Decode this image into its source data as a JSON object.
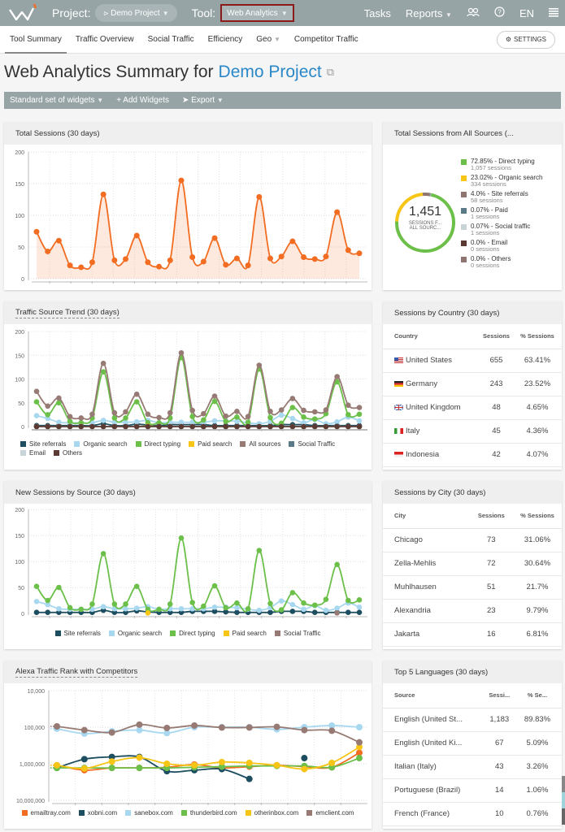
{
  "topbar": {
    "project_label": "Project:",
    "project_value": "Demo Project",
    "tool_label": "Tool:",
    "tool_value": "Web Analytics",
    "tasks": "Tasks",
    "reports": "Reports",
    "lang": "EN",
    "icons": [
      "users-icon",
      "help-icon",
      "menu-icon"
    ]
  },
  "subnav": {
    "tabs": [
      "Tool Summary",
      "Traffic Overview",
      "Social Traffic",
      "Efficiency",
      "Geo",
      "Competitor Traffic"
    ],
    "active": "Tool Summary",
    "settings": "SETTINGS"
  },
  "page": {
    "title_prefix": "Web Analytics Summary for",
    "title_project": "Demo Project"
  },
  "toolbar": {
    "widgets": "Standard set of widgets",
    "add": "+ Add Widgets",
    "export": "Export"
  },
  "total_sessions": {
    "title": "Total Sessions (30 days)"
  },
  "sources_donut": {
    "title": "Total Sessions from All Sources (...",
    "total": "1,451",
    "sub1": "SESSIONS F...",
    "sub2": "ALL SOURC...",
    "items": [
      {
        "label": "72.85% - Direct typing",
        "sessions": "1,057 sessions",
        "color": "#6cc04a",
        "pct": 72.85
      },
      {
        "label": "23.02% - Organic search",
        "sessions": "334 sessions",
        "color": "#f6c516",
        "pct": 23.02
      },
      {
        "label": "4.0% - Site referrals",
        "sessions": "58 sessions",
        "color": "#8f7570",
        "pct": 4.0
      },
      {
        "label": "0.07% - Paid",
        "sessions": "1 sessions",
        "color": "#5a7a87",
        "pct": 0.07
      },
      {
        "label": "0.07% - Social traffic",
        "sessions": "1 sessions",
        "color": "#c8d4d8",
        "pct": 0.07
      },
      {
        "label": "0.0% - Email",
        "sessions": "0 sessions",
        "color": "#5b3a34",
        "pct": 0
      },
      {
        "label": "0.0% - Others",
        "sessions": "0 sessions",
        "color": "#8f7570",
        "pct": 0
      }
    ]
  },
  "traffic_trend": {
    "title": "Traffic Source Trend (30 days)"
  },
  "new_sessions": {
    "title": "New Sessions by Source (30 days)"
  },
  "alexa": {
    "title": "Alexa Traffic Rank with Competitors"
  },
  "country": {
    "title": "Sessions by Country (30 days)",
    "headers": [
      "Country",
      "Sessions",
      "% Sessions"
    ],
    "rows": [
      {
        "name": "United States",
        "sessions": "655",
        "pct": "63.41%",
        "flag": "us"
      },
      {
        "name": "Germany",
        "sessions": "243",
        "pct": "23.52%",
        "flag": "de"
      },
      {
        "name": "United Kingdom",
        "sessions": "48",
        "pct": "4.65%",
        "flag": "gb"
      },
      {
        "name": "Italy",
        "sessions": "45",
        "pct": "4.36%",
        "flag": "it"
      },
      {
        "name": "Indonesia",
        "sessions": "42",
        "pct": "4.07%",
        "flag": "id"
      }
    ]
  },
  "city": {
    "title": "Sessions by City (30 days)",
    "headers": [
      "City",
      "Sessions",
      "% Sessions"
    ],
    "rows": [
      {
        "name": "Chicago",
        "sessions": "73",
        "pct": "31.06%"
      },
      {
        "name": "Zella-Mehlis",
        "sessions": "72",
        "pct": "30.64%"
      },
      {
        "name": "Muhlhausen",
        "sessions": "51",
        "pct": "21.7%"
      },
      {
        "name": "Alexandria",
        "sessions": "23",
        "pct": "9.79%"
      },
      {
        "name": "Jakarta",
        "sessions": "16",
        "pct": "6.81%"
      }
    ]
  },
  "languages": {
    "title": "Top 5 Languages (30 days)",
    "headers": [
      "Source",
      "Sessi...",
      "% Se..."
    ],
    "rows": [
      {
        "name": "English (United St...",
        "sessions": "1,183",
        "pct": "89.83%"
      },
      {
        "name": "English (United Ki...",
        "sessions": "67",
        "pct": "5.09%"
      },
      {
        "name": "Italian (Italy)",
        "sessions": "43",
        "pct": "3.26%"
      },
      {
        "name": "Portuguese (Brazil)",
        "sessions": "14",
        "pct": "1.06%"
      },
      {
        "name": "French (France)",
        "sessions": "10",
        "pct": "0.76%"
      }
    ]
  },
  "chart_data": [
    {
      "id": "total_sessions",
      "type": "area",
      "title": "Total Sessions (30 days)",
      "ylim": [
        0,
        200
      ],
      "yticks": [
        0,
        50,
        100,
        150,
        200
      ],
      "grid": true,
      "series": [
        {
          "name": "Sessions",
          "color": "#f26c22",
          "values": [
            74,
            43,
            60,
            21,
            18,
            26,
            133,
            29,
            31,
            68,
            26,
            19,
            29,
            155,
            34,
            27,
            64,
            22,
            32,
            21,
            129,
            32,
            35,
            59,
            34,
            31,
            35,
            105,
            45,
            40
          ]
        }
      ]
    },
    {
      "id": "traffic_trend",
      "type": "line",
      "title": "Traffic Source Trend (30 days)",
      "ylim": [
        0,
        200
      ],
      "yticks": [
        0,
        50,
        100,
        150,
        200
      ],
      "grid": true,
      "legend": "bottom",
      "series": [
        {
          "name": "Site referrals",
          "color": "#1d4e5f",
          "values": [
            2,
            2,
            2,
            2,
            2,
            2,
            6,
            2,
            2,
            5,
            3,
            2,
            4,
            4,
            4,
            4,
            2,
            2,
            2,
            2,
            2,
            2,
            4,
            4,
            4,
            2,
            2,
            2,
            2,
            2
          ]
        },
        {
          "name": "Organic search",
          "color": "#a8d8f0",
          "values": [
            23,
            17,
            9,
            8,
            8,
            8,
            13,
            9,
            9,
            10,
            13,
            8,
            9,
            9,
            9,
            9,
            12,
            12,
            11,
            8,
            6,
            11,
            24,
            17,
            8,
            15,
            6,
            10,
            20,
            12
          ]
        },
        {
          "name": "Direct typing",
          "color": "#6cc04a",
          "values": [
            52,
            25,
            50,
            11,
            8,
            18,
            115,
            18,
            18,
            52,
            8,
            8,
            18,
            145,
            21,
            14,
            53,
            11,
            20,
            9,
            121,
            19,
            7,
            40,
            20,
            16,
            27,
            94,
            25,
            26
          ]
        },
        {
          "name": "Paid search",
          "color": "#f6c516",
          "values": [
            0,
            0,
            0,
            0,
            0,
            0,
            0,
            0,
            0,
            0,
            1,
            0,
            0,
            0,
            0,
            0,
            0,
            0,
            0,
            0,
            0,
            0,
            0,
            0,
            0,
            0,
            0,
            0,
            0,
            0
          ]
        },
        {
          "name": "All sources",
          "color": "#967a73",
          "values": [
            74,
            43,
            60,
            21,
            18,
            26,
            133,
            29,
            31,
            68,
            26,
            19,
            29,
            155,
            34,
            27,
            64,
            22,
            32,
            21,
            129,
            32,
            35,
            59,
            34,
            31,
            35,
            105,
            45,
            40
          ]
        },
        {
          "name": "Social Traffic",
          "color": "#5a7a87",
          "values": [
            0,
            0,
            0,
            0,
            0,
            0,
            0,
            0,
            0,
            0,
            0,
            0,
            0,
            0,
            0,
            0,
            0,
            0,
            0,
            0,
            0,
            0,
            0,
            0,
            0,
            0,
            0,
            1,
            0,
            0
          ]
        },
        {
          "name": "Email",
          "color": "#c8d4d8",
          "values": [
            0,
            0,
            0,
            0,
            0,
            0,
            0,
            0,
            0,
            0,
            0,
            0,
            0,
            0,
            0,
            0,
            0,
            0,
            0,
            0,
            0,
            0,
            0,
            0,
            0,
            0,
            0,
            0,
            0,
            0
          ]
        },
        {
          "name": "Others",
          "color": "#5b3a34",
          "values": [
            0,
            0,
            0,
            0,
            0,
            0,
            0,
            0,
            0,
            0,
            0,
            0,
            0,
            0,
            0,
            0,
            0,
            0,
            0,
            0,
            0,
            0,
            0,
            0,
            0,
            0,
            0,
            0,
            0,
            0
          ]
        }
      ]
    },
    {
      "id": "new_sessions",
      "type": "line",
      "title": "New Sessions by Source (30 days)",
      "ylim": [
        0,
        200
      ],
      "yticks": [
        0,
        50,
        100,
        150,
        200
      ],
      "grid": true,
      "legend": "bottom",
      "series": [
        {
          "name": "Site referrals",
          "color": "#1d4e5f",
          "values": [
            2,
            2,
            2,
            2,
            2,
            2,
            6,
            2,
            2,
            5,
            3,
            2,
            2,
            2,
            4,
            4,
            4,
            3,
            2,
            2,
            2,
            2,
            4,
            4,
            4,
            2,
            2,
            2,
            2,
            2
          ]
        },
        {
          "name": "Organic search",
          "color": "#a8d8f0",
          "values": [
            23,
            17,
            9,
            8,
            8,
            8,
            13,
            9,
            9,
            10,
            13,
            8,
            9,
            9,
            9,
            9,
            12,
            12,
            11,
            8,
            6,
            11,
            24,
            17,
            8,
            15,
            6,
            10,
            20,
            12
          ]
        },
        {
          "name": "Direct typing",
          "color": "#6cc04a",
          "values": [
            52,
            25,
            50,
            11,
            8,
            18,
            115,
            18,
            18,
            52,
            8,
            8,
            18,
            145,
            21,
            14,
            53,
            11,
            20,
            9,
            121,
            19,
            7,
            40,
            20,
            16,
            27,
            94,
            25,
            26
          ]
        },
        {
          "name": "Paid search",
          "color": "#f6c516",
          "values": [
            null,
            null,
            null,
            null,
            null,
            null,
            null,
            null,
            null,
            null,
            1,
            null,
            null,
            null,
            null,
            null,
            null,
            null,
            null,
            null,
            null,
            null,
            null,
            null,
            null,
            null,
            null,
            null,
            null,
            null
          ]
        },
        {
          "name": "Social Traffic",
          "color": "#967a73",
          "values": [
            null,
            null,
            null,
            null,
            null,
            null,
            null,
            null,
            null,
            null,
            null,
            null,
            null,
            null,
            null,
            null,
            null,
            null,
            null,
            null,
            null,
            null,
            null,
            null,
            null,
            null,
            null,
            1,
            null,
            null
          ]
        }
      ]
    },
    {
      "id": "alexa",
      "type": "line",
      "title": "Alexa Traffic Rank with Competitors",
      "yscale": "log-reversed",
      "ylim": [
        10000,
        10000000
      ],
      "yticks": [
        "10,000",
        "100,000",
        "1,000,000",
        "10,000,000"
      ],
      "grid": true,
      "legend": "bottom",
      "series": [
        {
          "name": "emailtray.com",
          "color": "#f26c22",
          "values": [
            1100000,
            1500000,
            1300000,
            1300000,
            1250000,
            1050000,
            1300000,
            1200000,
            1100000,
            1200000,
            1250000,
            500000
          ]
        },
        {
          "name": "xobni.com",
          "color": "#1d4e5f",
          "values": [
            1300000,
            750000,
            650000,
            650000,
            1600000,
            1500000,
            1400000,
            2600000,
            null,
            700000,
            null,
            null
          ]
        },
        {
          "name": "sanebox.com",
          "color": "#a8d8f0",
          "values": [
            110000,
            150000,
            130000,
            120000,
            145000,
            100000,
            100000,
            100000,
            115000,
            100000,
            90000,
            100000
          ]
        },
        {
          "name": "thunderbird.com",
          "color": "#6cc04a",
          "values": [
            1300000,
            1300000,
            1300000,
            1300000,
            1300000,
            1250000,
            1200000,
            1150000,
            1150000,
            1150000,
            1250000,
            700000
          ]
        },
        {
          "name": "otherinbox.com",
          "color": "#f6c516",
          "values": [
            1100000,
            1350000,
            870000,
            680000,
            1000000,
            1100000,
            900000,
            950000,
            1100000,
            1400000,
            950000,
            350000
          ]
        },
        {
          "name": "emclient.com",
          "color": "#967a73",
          "values": [
            95000,
            120000,
            140000,
            85000,
            105000,
            90000,
            102000,
            102000,
            98000,
            120000,
            125000,
            260000
          ]
        }
      ]
    }
  ]
}
